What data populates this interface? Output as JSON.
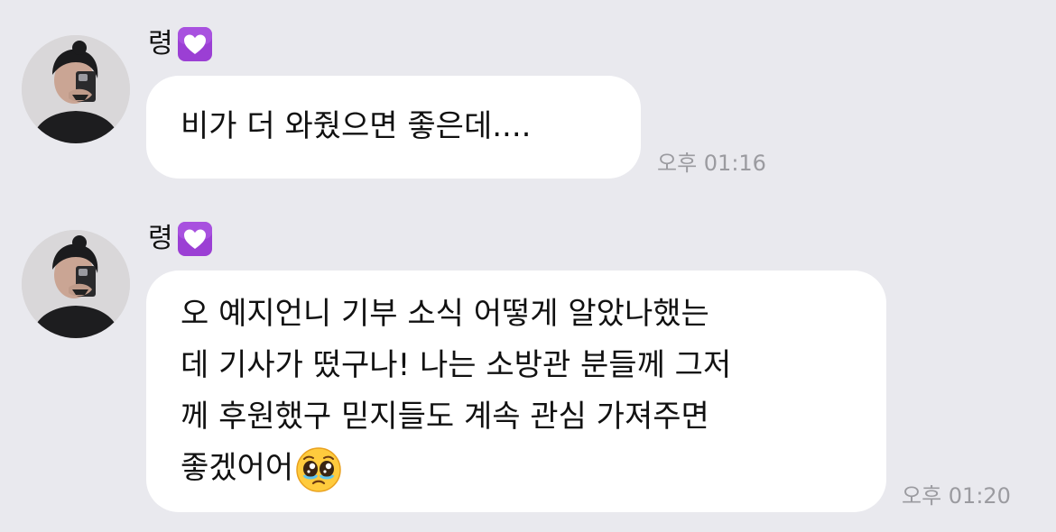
{
  "messages": [
    {
      "sender": "령",
      "sender_badge_icon": "purple-heart-icon",
      "text": "비가 더 와줬으면 좋은데....",
      "time": "오후 01:16"
    },
    {
      "sender": "령",
      "sender_badge_icon": "purple-heart-icon",
      "text": "오 예지언니 기부 소식 어떻게 알았나했는\n데 기사가 떴구나! 나는 소방관 분들께 그저\n께 후원했구 믿지들도 계속 관심 가져주면\n좋겠어어",
      "trailing_emoji_icon": "pleading-face-emoji-icon",
      "time": "오후 01:20"
    }
  ],
  "colors": {
    "background": "#e9e9ee",
    "bubble": "#ffffff",
    "timestamp": "#9b9ba0",
    "heart_badge": "#9b3fd4"
  }
}
